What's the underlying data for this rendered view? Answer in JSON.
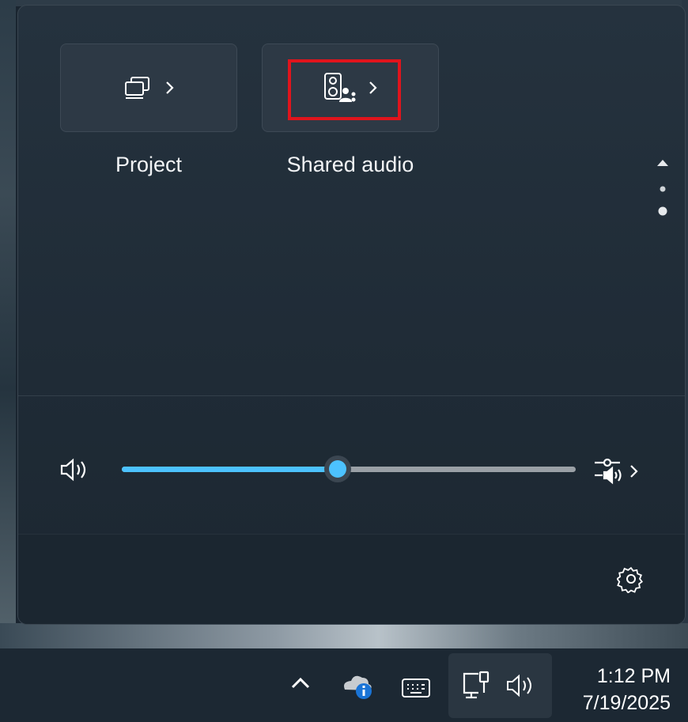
{
  "quick_settings": {
    "tiles": [
      {
        "label": "Project",
        "icon": "project-icon"
      },
      {
        "label": "Shared audio",
        "icon": "shared-audio-icon"
      }
    ],
    "volume": {
      "level": 0.475,
      "icon": "speaker-icon",
      "mixer_icon": "sound-mixer-icon"
    },
    "footer": {
      "icon": "settings-gear-icon"
    },
    "highlight_color": "#e0141c",
    "accent_color": "#4cc2ff"
  },
  "taskbar": {
    "tray_icons": [
      "chevron-up-icon",
      "onedrive-icon",
      "keyboard-icon",
      "network-icon",
      "volume-icon"
    ],
    "clock": {
      "time": "1:12 PM",
      "date": "7/19/2025"
    }
  }
}
